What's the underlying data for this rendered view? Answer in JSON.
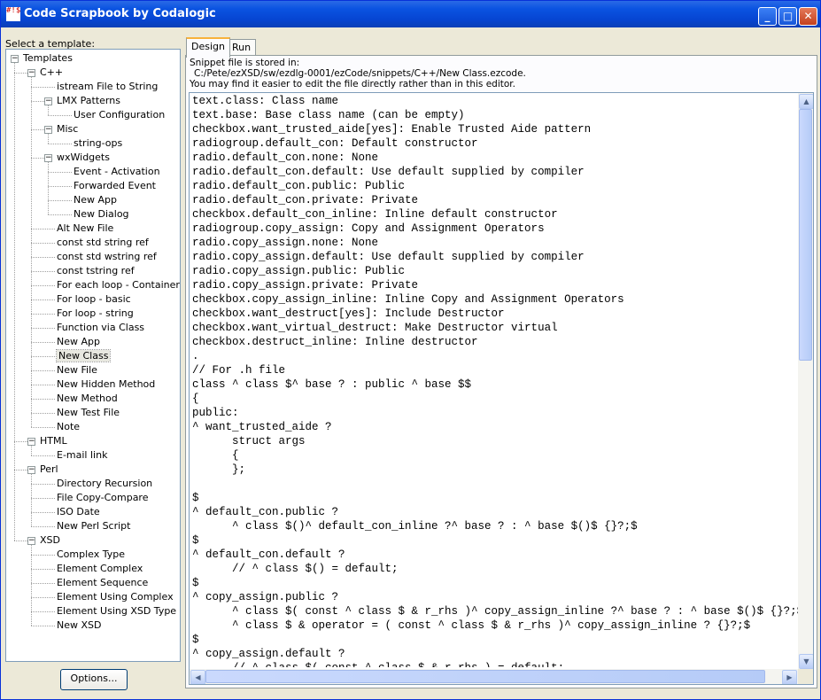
{
  "window": {
    "title": "Code Scrapbook by Codalogic",
    "app_icon_text": "#!$%"
  },
  "left": {
    "label": "Select a template:",
    "options_button": "Options..."
  },
  "tree": {
    "root": "Templates",
    "nodes": [
      {
        "label": "Templates",
        "depth": 0,
        "expanded": true
      },
      {
        "label": "C++",
        "depth": 1,
        "expanded": true
      },
      {
        "label": "istream File to String",
        "depth": 2
      },
      {
        "label": "LMX Patterns",
        "depth": 2,
        "expanded": true
      },
      {
        "label": "User Configuration",
        "depth": 3
      },
      {
        "label": "Misc",
        "depth": 2,
        "expanded": true
      },
      {
        "label": "string-ops",
        "depth": 3
      },
      {
        "label": "wxWidgets",
        "depth": 2,
        "expanded": true
      },
      {
        "label": "Event - Activation",
        "depth": 3
      },
      {
        "label": "Forwarded Event",
        "depth": 3
      },
      {
        "label": "New App",
        "depth": 3
      },
      {
        "label": "New Dialog",
        "depth": 3
      },
      {
        "label": "Alt New File",
        "depth": 2
      },
      {
        "label": "const std string ref",
        "depth": 2
      },
      {
        "label": "const std wstring ref",
        "depth": 2
      },
      {
        "label": "const tstring ref",
        "depth": 2
      },
      {
        "label": "For each loop - Container",
        "depth": 2
      },
      {
        "label": "For loop - basic",
        "depth": 2
      },
      {
        "label": "For loop - string",
        "depth": 2
      },
      {
        "label": "Function via Class",
        "depth": 2
      },
      {
        "label": "New App",
        "depth": 2
      },
      {
        "label": "New Class",
        "depth": 2,
        "selected": true
      },
      {
        "label": "New File",
        "depth": 2
      },
      {
        "label": "New Hidden Method",
        "depth": 2
      },
      {
        "label": "New Method",
        "depth": 2
      },
      {
        "label": "New Test File",
        "depth": 2
      },
      {
        "label": "Note",
        "depth": 2
      },
      {
        "label": "HTML",
        "depth": 1,
        "expanded": true
      },
      {
        "label": "E-mail link",
        "depth": 2
      },
      {
        "label": "Perl",
        "depth": 1,
        "expanded": true
      },
      {
        "label": "Directory Recursion",
        "depth": 2
      },
      {
        "label": "File Copy-Compare",
        "depth": 2
      },
      {
        "label": "ISO Date",
        "depth": 2
      },
      {
        "label": "New Perl Script",
        "depth": 2
      },
      {
        "label": "XSD",
        "depth": 1,
        "expanded": true
      },
      {
        "label": "Complex Type",
        "depth": 2
      },
      {
        "label": "Element Complex",
        "depth": 2
      },
      {
        "label": "Element Sequence",
        "depth": 2
      },
      {
        "label": "Element Using Complex",
        "depth": 2
      },
      {
        "label": "Element Using XSD Type",
        "depth": 2
      },
      {
        "label": "New XSD",
        "depth": 2
      }
    ]
  },
  "tabs": {
    "design": "Design",
    "run": "Run",
    "active": "Design"
  },
  "info": {
    "line1": "Snippet file is stored in:",
    "line2": "C:/Pete/ezXSD/sw/ezdlg-0001/ezCode/snippets/C++/New Class.ezcode.",
    "line3": "You may find it easier to edit the file directly rather than in this editor."
  },
  "code_lines": [
    "text.class: Class name",
    "text.base: Base class name (can be empty)",
    "checkbox.want_trusted_aide[yes]: Enable Trusted Aide pattern",
    "radiogroup.default_con: Default constructor",
    "radio.default_con.none: None",
    "radio.default_con.default: Use default supplied by compiler",
    "radio.default_con.public: Public",
    "radio.default_con.private: Private",
    "checkbox.default_con_inline: Inline default constructor",
    "radiogroup.copy_assign: Copy and Assignment Operators",
    "radio.copy_assign.none: None",
    "radio.copy_assign.default: Use default supplied by compiler",
    "radio.copy_assign.public: Public",
    "radio.copy_assign.private: Private",
    "checkbox.copy_assign_inline: Inline Copy and Assignment Operators",
    "checkbox.want_destruct[yes]: Include Destructor",
    "checkbox.want_virtual_destruct: Make Destructor virtual",
    "checkbox.destruct_inline: Inline destructor",
    ".",
    "// For .h file",
    "class ^ class $^ base ? : public ^ base $$",
    "{",
    "public:",
    "^ want_trusted_aide ?",
    "      struct args",
    "      {",
    "      };",
    "",
    "$",
    "^ default_con.public ?",
    "      ^ class $()^ default_con_inline ?^ base ? : ^ base $()$ {}?;$",
    "$",
    "^ default_con.default ?",
    "      // ^ class $() = default;",
    "$",
    "^ copy_assign.public ?",
    "      ^ class $( const ^ class $ & r_rhs )^ copy_assign_inline ?^ base ? : ^ base $()$ {}?;$",
    "      ^ class $ & operator = ( const ^ class $ & r_rhs )^ copy_assign_inline ? {}?;$",
    "$",
    "^ copy_assign.default ?",
    "      // ^ class $( const ^ class $ & r_rhs ) = default;"
  ],
  "colors": {
    "title_bar": "#0a53e1",
    "tab_highlight": "#f8b23c",
    "tree_border": "#7f9db9"
  }
}
